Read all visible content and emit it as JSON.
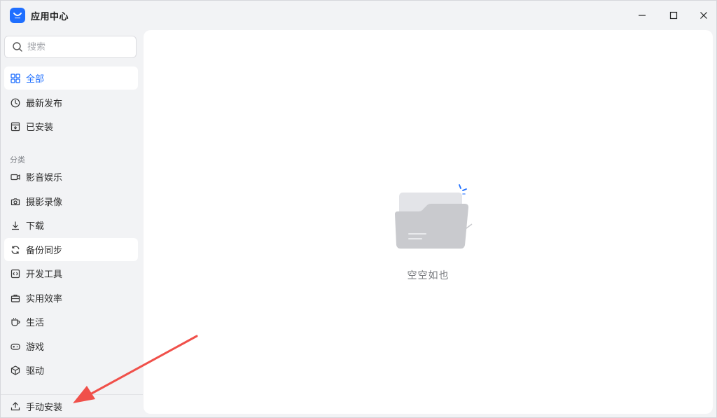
{
  "window": {
    "title": "应用中心",
    "controls": {
      "minimize": "minimize-icon",
      "maximize": "maximize-icon",
      "close": "close-icon"
    }
  },
  "sidebar": {
    "search": {
      "placeholder": "搜索",
      "value": ""
    },
    "main_items": [
      {
        "label": "全部",
        "icon": "grid-icon",
        "state": "active"
      },
      {
        "label": "最新发布",
        "icon": "clock-icon",
        "state": "normal"
      },
      {
        "label": "已安装",
        "icon": "installed-box-icon",
        "state": "normal"
      }
    ],
    "section_label": "分类",
    "category_items": [
      {
        "label": "影音娱乐",
        "icon": "video-camera-icon",
        "state": "normal"
      },
      {
        "label": "摄影录像",
        "icon": "camera-icon",
        "state": "normal"
      },
      {
        "label": "下载",
        "icon": "download-icon",
        "state": "normal"
      },
      {
        "label": "备份同步",
        "icon": "sync-icon",
        "state": "hover"
      },
      {
        "label": "开发工具",
        "icon": "code-icon",
        "state": "normal"
      },
      {
        "label": "实用效率",
        "icon": "toolbox-icon",
        "state": "normal"
      },
      {
        "label": "生活",
        "icon": "cup-icon",
        "state": "normal"
      },
      {
        "label": "游戏",
        "icon": "gamepad-icon",
        "state": "normal"
      },
      {
        "label": "驱动",
        "icon": "cube-icon",
        "state": "normal"
      }
    ],
    "footer_action": {
      "label": "手动安装",
      "icon": "upload-icon"
    }
  },
  "main": {
    "empty_state": {
      "icon": "empty-folder-illustration",
      "text": "空空如也"
    }
  },
  "colors": {
    "accent": "#1f6fff",
    "background": "#f2f3f5",
    "panel": "#ffffff",
    "annotation": "#f0504a"
  }
}
